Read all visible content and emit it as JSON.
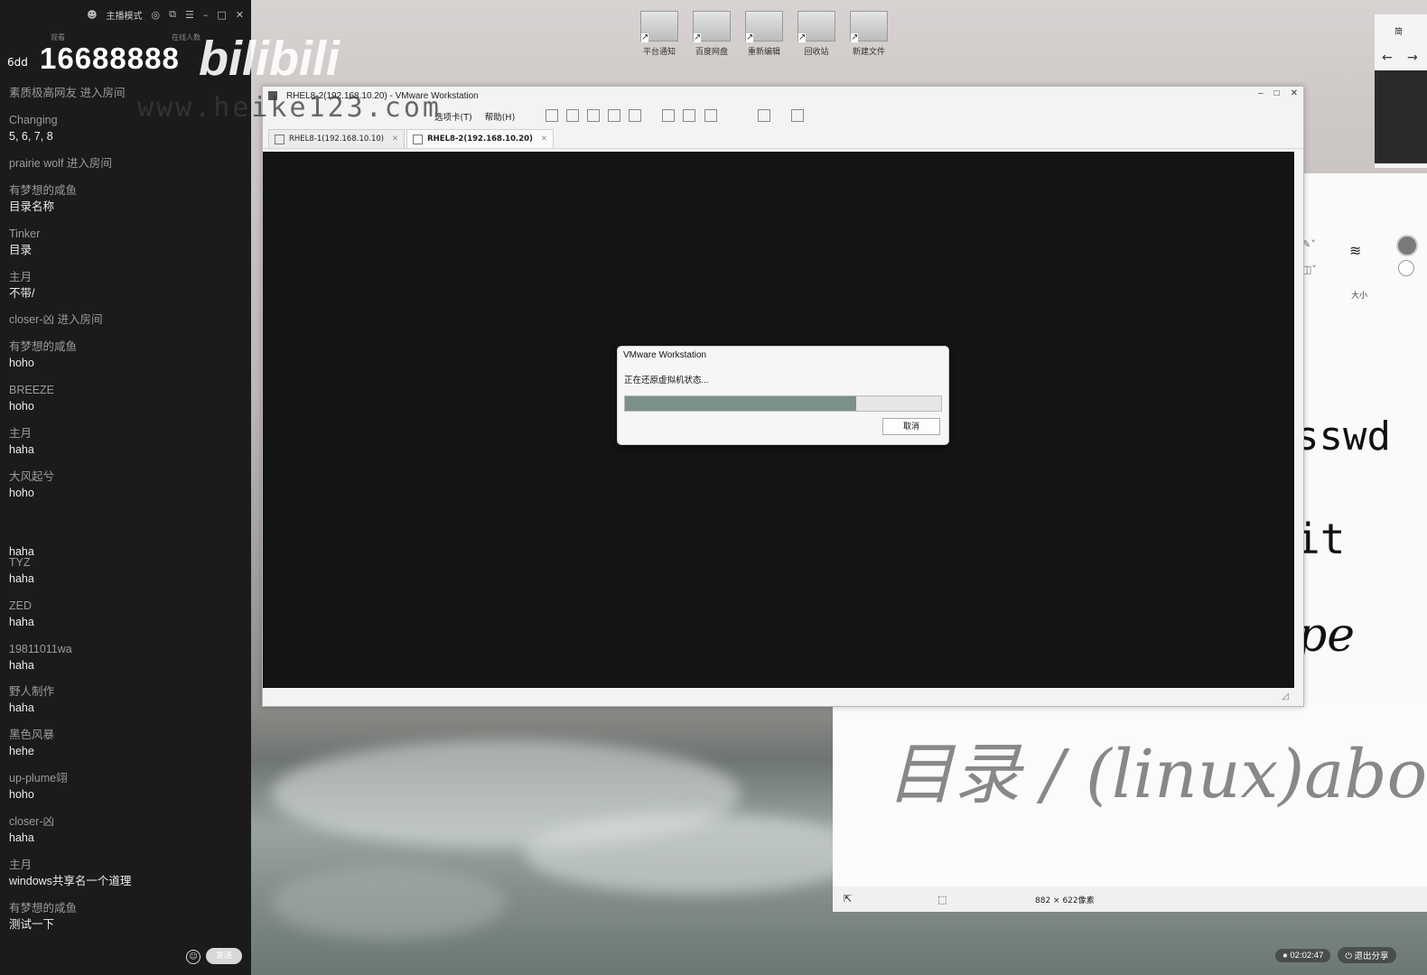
{
  "desktop": {
    "icons": [
      {
        "label": "平台通知"
      },
      {
        "label": "百度网盘"
      },
      {
        "label": "重新编辑"
      },
      {
        "label": "回收站"
      },
      {
        "label": "新建文件"
      }
    ]
  },
  "chat": {
    "mode_label": "主播模式",
    "sub_left": "观看",
    "sub_right": "在线人数",
    "watermark": {
      "room_prefix": "6dd",
      "phone": "16688888",
      "brand": "bilibili",
      "url": "www.heike123.com"
    },
    "messages": [
      {
        "user": "",
        "text": "素质极高网友 进入房间",
        "system": true
      },
      {
        "user": "Changing",
        "text": "5, 6, 7, 8"
      },
      {
        "user": "",
        "text": "prairie wolf 进入房间",
        "system": true
      },
      {
        "user": "有梦想的咸鱼",
        "text": "目录名称"
      },
      {
        "user": "Tinker",
        "text": "目录"
      },
      {
        "user": "主月",
        "text": "不带/"
      },
      {
        "user": "",
        "text": "closer-凶    进入房间",
        "system": true
      },
      {
        "user": "有梦想的咸鱼",
        "text": "hoho"
      },
      {
        "user": "BREEZE",
        "text": "hoho"
      },
      {
        "user": "主月",
        "text": "haha"
      },
      {
        "user": "大风起兮",
        "text": "hoho"
      },
      {
        "user": "",
        "text": "haha"
      },
      {
        "user": "TYZ",
        "text": "haha"
      },
      {
        "user": "ZED",
        "text": "haha"
      },
      {
        "user": "19811011wa",
        "text": "haha"
      },
      {
        "user": "野人制作",
        "text": "haha"
      },
      {
        "user": "黑色风暴",
        "text": "hehe"
      },
      {
        "user": "up-plume翊",
        "text": "hoho"
      },
      {
        "user": "closer-凶",
        "text": "haha"
      },
      {
        "user": "主月",
        "text": "windows共享名一个道理"
      },
      {
        "user": "有梦想的咸鱼",
        "text": "测试一下"
      }
    ],
    "send_label": "发送"
  },
  "vmware": {
    "title": "RHEL8-2(192.168.10.20) - VMware Workstation",
    "menus": [
      "选项卡(T)",
      "帮助(H)"
    ],
    "tabs": [
      {
        "label": "RHEL8-1(192.168.10.10)",
        "active": false
      },
      {
        "label": "RHEL8-2(192.168.10.20)",
        "active": true
      }
    ],
    "dialog": {
      "title": "VMware Workstation",
      "message": "正在还原虚拟机状态...",
      "progress": 0.73,
      "cancel_label": "取消"
    }
  },
  "whiteboard": {
    "size_label": "大小",
    "text_lines": [
      "sswd",
      "it",
      "pe"
    ],
    "handwriting": "目录 / (linux)abo"
  },
  "paint": {
    "dimensions": "882 × 622像素"
  },
  "tray": {
    "time": "02:02:47",
    "exit_label": "退出分享"
  },
  "right_app": {
    "title": "简"
  },
  "colors": {
    "chat_bg": "#1b1b1b",
    "vm_screen": "#141414",
    "progress_fill": "#7b8f8b"
  }
}
